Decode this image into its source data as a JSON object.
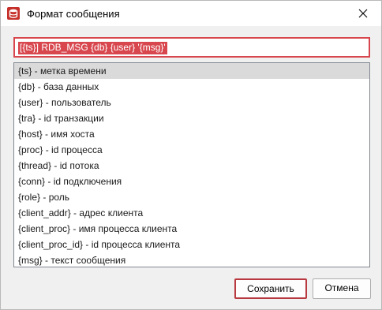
{
  "window": {
    "title": "Формат сообщения",
    "close_icon": "close-icon",
    "app_icon": "database-icon"
  },
  "format_input": {
    "value": "[{ts}] RDB_MSG {db} {user} '{msg}'"
  },
  "variables": [
    {
      "label": "{ts} - метка времени",
      "selected": true
    },
    {
      "label": "{db} - база данных"
    },
    {
      "label": "{user} - пользователь"
    },
    {
      "label": "{tra} - id транзакции"
    },
    {
      "label": "{host} - имя хоста"
    },
    {
      "label": "{proc} - id процесса"
    },
    {
      "label": "{thread} - id потока"
    },
    {
      "label": "{conn} - id подключения"
    },
    {
      "label": "{role} - роль"
    },
    {
      "label": "{client_addr} - адрес клиента"
    },
    {
      "label": "{client_proc} - имя процесса клиента"
    },
    {
      "label": "{client_proc_id} - id процесса клиента"
    },
    {
      "label": "{msg} - текст сообщения"
    }
  ],
  "buttons": {
    "save": "Сохранить",
    "cancel": "Отмена"
  },
  "colors": {
    "accent": "#d8474e",
    "selection": "#dadada"
  }
}
